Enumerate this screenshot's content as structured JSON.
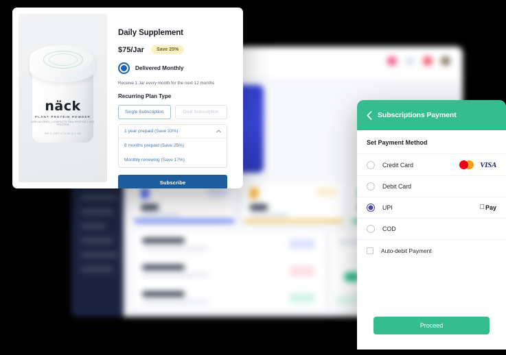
{
  "background_dashboard": {
    "name": "blurred-dashboard-window",
    "sidebar_color": "#1b2340",
    "hero_color": "#2e3cc9",
    "accent_green": "#35bd92"
  },
  "product_card": {
    "title": "Daily Supplement",
    "price": "$75/Jar",
    "save_badge": "Save 25%",
    "delivery_option": "Delivered Monthly",
    "delivery_note": "Receive 1 Jar every month for the next 12 months",
    "section_label": "Recurring Plan Type",
    "segments": [
      {
        "label": "Single Subscription",
        "selected": true
      },
      {
        "label": "Dual Subscription",
        "selected": false
      }
    ],
    "plan_dropdown": {
      "selected": "1 year prepaid (Save 33%)",
      "chevron": "chevron-up-icon",
      "options": [
        "6 months prepaid (Save 25%)",
        "Monthly renewing (Save 17%)"
      ]
    },
    "subscribe_label": "Subscribe",
    "subscribe_color": "#1e5c9c",
    "photo": {
      "brand": "näck",
      "line1": "PLANT PROTEIN POWDER",
      "line2": "UNFLAVORED  |  COMPLETE EAA PROFILE  |  20G PROTEIN",
      "line3": "500 G  |  NET 17.6 OZ (1.1 LB)"
    }
  },
  "payment_panel": {
    "header_title": "Subscriptions Payment",
    "back_icon": "chevron-left-icon",
    "header_color": "#35bd8f",
    "section_title": "Set Payment Method",
    "methods": [
      {
        "label": "Credit Card",
        "selected": false,
        "logos": [
          "mastercard-logo",
          "visa-logo"
        ]
      },
      {
        "label": "Debit Card",
        "selected": false,
        "logos": []
      },
      {
        "label": "UPI",
        "selected": true,
        "logos": [
          "apple-pay-logo"
        ]
      },
      {
        "label": "COD",
        "selected": false,
        "logos": []
      }
    ],
    "auto_debit": {
      "label": "Auto-debit Payment",
      "checked": false
    },
    "proceed_label": "Proceed",
    "selected_radio_color": "#4b45a8"
  }
}
